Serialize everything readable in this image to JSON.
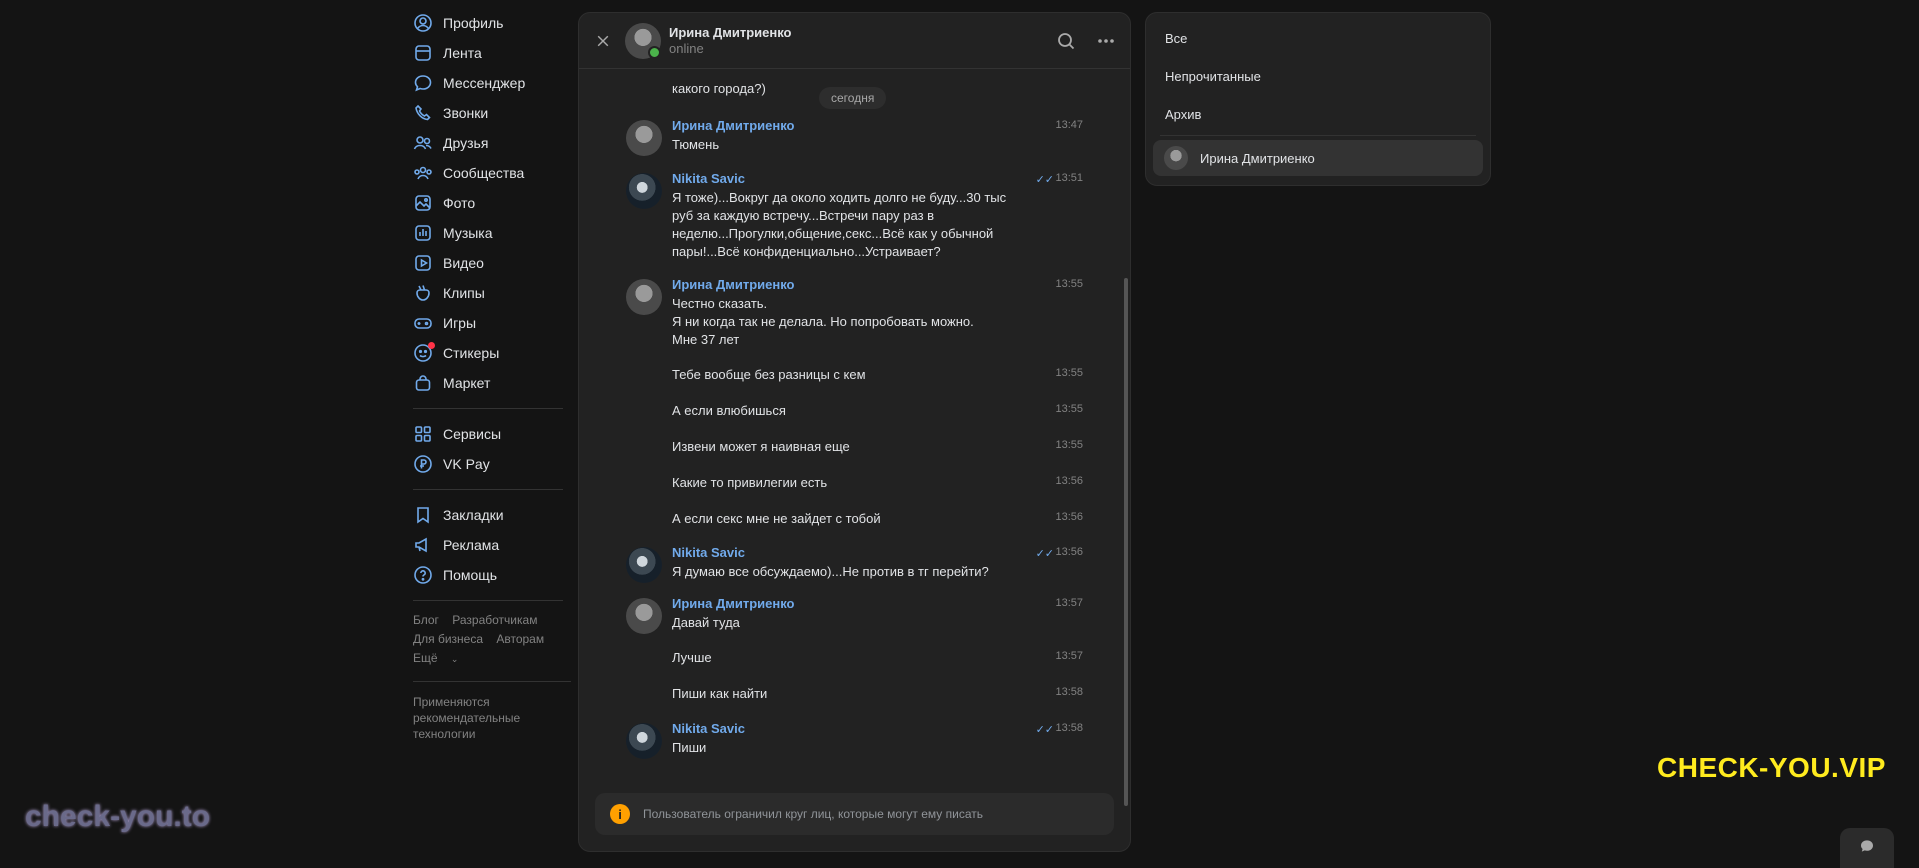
{
  "sidebar": {
    "items": [
      {
        "label": "Профиль",
        "icon": "profile-icon"
      },
      {
        "label": "Лента",
        "icon": "feed-icon"
      },
      {
        "label": "Мессенджер",
        "icon": "messenger-icon"
      },
      {
        "label": "Звонки",
        "icon": "phone-icon"
      },
      {
        "label": "Друзья",
        "icon": "friends-icon"
      },
      {
        "label": "Сообщества",
        "icon": "communities-icon"
      },
      {
        "label": "Фото",
        "icon": "photo-icon"
      },
      {
        "label": "Музыка",
        "icon": "music-icon"
      },
      {
        "label": "Видео",
        "icon": "video-icon"
      },
      {
        "label": "Клипы",
        "icon": "clips-icon"
      },
      {
        "label": "Игры",
        "icon": "games-icon"
      },
      {
        "label": "Стикеры",
        "icon": "stickers-icon"
      },
      {
        "label": "Маркет",
        "icon": "market-icon"
      }
    ],
    "services": [
      {
        "label": "Сервисы",
        "icon": "services-icon"
      },
      {
        "label": "VK Pay",
        "icon": "vkpay-icon"
      }
    ],
    "extra": [
      {
        "label": "Закладки",
        "icon": "bookmarks-icon"
      },
      {
        "label": "Реклама",
        "icon": "ads-icon"
      },
      {
        "label": "Помощь",
        "icon": "help-icon"
      }
    ],
    "footer": {
      "blog": "Блог",
      "developers": "Разработчикам",
      "business": "Для бизнеса",
      "authors": "Авторам",
      "more": "Ещё"
    },
    "recommendations": "Применяются рекомендательные технологии"
  },
  "chat": {
    "contact_name": "Ирина Дмитриенко",
    "status": "online",
    "date_divider": "сегодня",
    "partial_message": "какого города?)",
    "messages": [
      {
        "author": "Ирина Дмитриенко",
        "text": "Тюмень",
        "time": "13:47"
      },
      {
        "author": "Nikita Savic",
        "text": "Я тоже)...Вокруг да около ходить долго не буду...30 тыс руб за каждую встречу...Встречи пару раз в неделю...Прогулки,общение,секс...Всё как у обычной пары!...Всё конфиденциально...Устраивает?",
        "time": "13:51"
      },
      {
        "author": "Ирина Дмитриенко",
        "text": "Честно сказать.\nЯ ни когда так не делала. Но попробовать можно.\nМне 37 лет",
        "time": "13:55"
      },
      {
        "text": "Тебе вообще без разницы с кем",
        "time": "13:55"
      },
      {
        "text": "А если влюбишься",
        "time": "13:55"
      },
      {
        "text": "Извени может я наивная еще",
        "time": "13:55"
      },
      {
        "text": "Какие то привилегии есть",
        "time": "13:56"
      },
      {
        "text": "А если секс мне не зайдет с тобой",
        "time": "13:56"
      },
      {
        "author": "Nikita Savic",
        "text": "Я думаю все обсуждаемо)...Не против в тг перейти?",
        "time": "13:56"
      },
      {
        "author": "Ирина Дмитриенко",
        "text": "Давай туда",
        "time": "13:57"
      },
      {
        "text": "Лучше",
        "time": "13:57"
      },
      {
        "text": "Пиши как найти",
        "time": "13:58"
      },
      {
        "author": "Nikita Savic",
        "text": "Пиши",
        "time": "13:58"
      }
    ],
    "notice": "Пользователь ограничил круг лиц, которые могут ему писать"
  },
  "filters": {
    "all": "Все",
    "unread": "Непрочитанные",
    "archive": "Архив",
    "selected": "Ирина Дмитриенко"
  },
  "watermarks": {
    "right": "CHECK-YOU.VIP",
    "left": "check-you.to"
  }
}
